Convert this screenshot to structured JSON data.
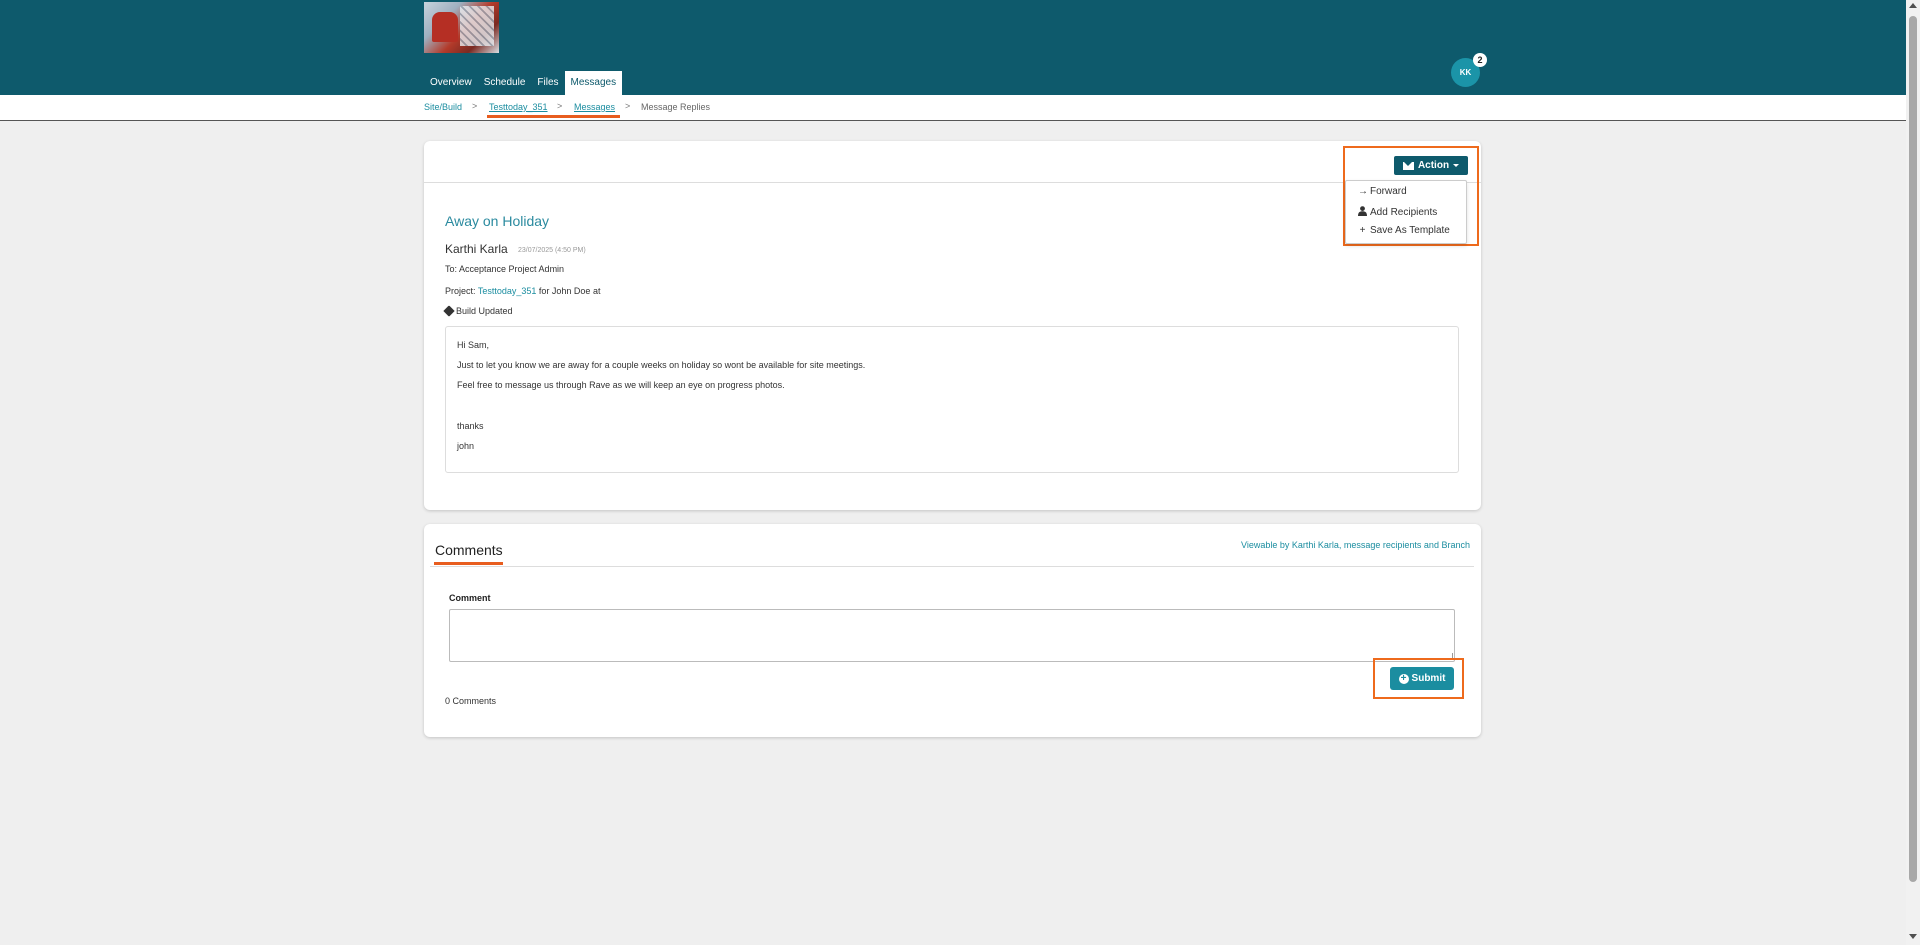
{
  "header": {
    "nav": [
      {
        "label": "Overview"
      },
      {
        "label": "Schedule"
      },
      {
        "label": "Files"
      },
      {
        "label": "Messages"
      }
    ],
    "avatar_initials": "KK",
    "notification_count": "2"
  },
  "breadcrumb": {
    "items": [
      "Site/Build",
      "Testtoday_351",
      "Messages",
      "Message Replies"
    ],
    "separator": ">"
  },
  "message": {
    "action_label": "Action",
    "action_menu": [
      {
        "label": "Forward",
        "icon": "arrow-right-icon"
      },
      {
        "label": "Add Recipients",
        "icon": "user-icon"
      },
      {
        "label": "Save As Template",
        "icon": "plus-icon"
      }
    ],
    "title": "Away on Holiday",
    "sender": "Karthi Karla",
    "date": "23/07/2025 (4:50 PM)",
    "to": "To: Acceptance Project Admin",
    "project_prefix": "Project: ",
    "project_link": "Testtoday_351",
    "project_suffix": " for John Doe at",
    "tag": "Build Updated",
    "body": [
      "Hi Sam,",
      "Just to let you know we are away for a couple weeks on holiday so wont be available for site meetings.",
      "Feel free to message us through Rave as we will keep an eye on progress photos.",
      "",
      "thanks",
      "john"
    ]
  },
  "comments": {
    "title": "Comments",
    "viewable": "Viewable by Karthi Karla, message recipients and Branch",
    "label": "Comment",
    "submit_label": "Submit",
    "count_text": "0 Comments"
  },
  "colors": {
    "header_bg": "#0e5a6c",
    "accent": "#1b8da0",
    "highlight": "#ee6a1c"
  }
}
